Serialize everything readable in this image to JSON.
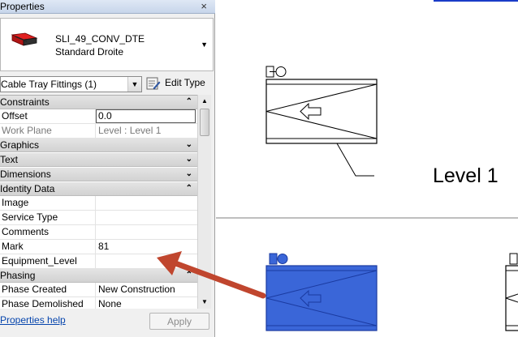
{
  "panel": {
    "title": "Properties",
    "close_glyph": "×",
    "type_selector": {
      "family": "SLI_49_CONV_DTE",
      "type": "Standard Droite",
      "thumbnail_icon": "cable-tray-fitting-thumbnail"
    },
    "filter": {
      "value": "Cable Tray Fittings (1)"
    },
    "edit_type_label": "Edit Type",
    "groups": [
      {
        "label": "Constraints",
        "state": "expanded"
      },
      {
        "label": "Graphics",
        "state": "collapsed"
      },
      {
        "label": "Text",
        "state": "collapsed"
      },
      {
        "label": "Dimensions",
        "state": "collapsed"
      },
      {
        "label": "Identity Data",
        "state": "expanded"
      },
      {
        "label": "Phasing",
        "state": "expanded"
      }
    ],
    "props": {
      "offset": {
        "label": "Offset",
        "value": "0.0"
      },
      "work_plane": {
        "label": "Work Plane",
        "value": "Level : Level 1"
      },
      "image": {
        "label": "Image",
        "value": ""
      },
      "service_type": {
        "label": "Service Type",
        "value": ""
      },
      "comments": {
        "label": "Comments",
        "value": ""
      },
      "mark": {
        "label": "Mark",
        "value": "81"
      },
      "equipment_level": {
        "label": "Equipment_Level",
        "value": ""
      },
      "phase_created": {
        "label": "Phase Created",
        "value": "New Construction"
      },
      "phase_demolished": {
        "label": "Phase Demolished",
        "value": "None"
      }
    },
    "help_link": "Properties help",
    "apply_label": "Apply"
  },
  "canvas": {
    "level_label": "Level 1",
    "selection_color": "#3a66d8",
    "annotation_arrow_color": "#c0462e"
  }
}
